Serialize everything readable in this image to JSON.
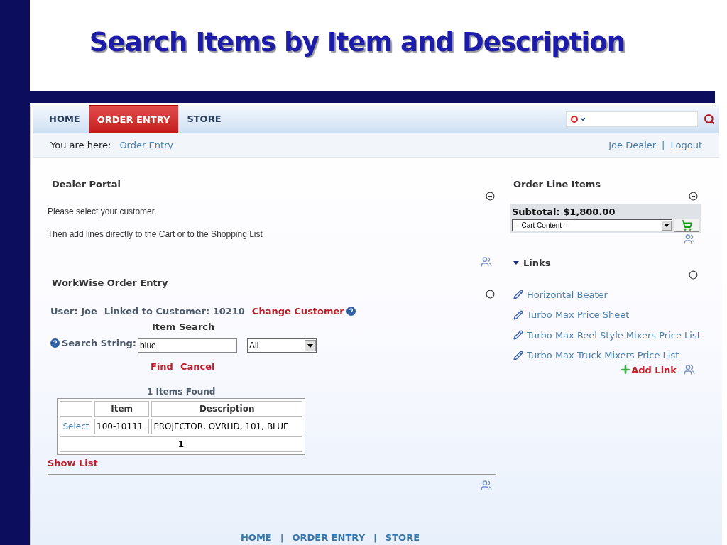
{
  "slide": {
    "title": "Search Items by Item and Description"
  },
  "nav": {
    "tabs": [
      {
        "label": "HOME",
        "selected": false
      },
      {
        "label": "ORDER ENTRY",
        "selected": true
      },
      {
        "label": "STORE",
        "selected": false
      }
    ]
  },
  "breadcrumb": {
    "label": "You are here:",
    "current": "Order Entry"
  },
  "user_links": {
    "items": [
      "Joe Dealer",
      "Logout"
    ],
    "separator": "|"
  },
  "dealer_portal": {
    "title": "Dealer Portal",
    "lines": [
      "Please select your customer,",
      "Then add lines directly to the Cart or to the Shopping List"
    ]
  },
  "order_entry": {
    "title": "WorkWise Order Entry",
    "user": "User: Joe",
    "customer": "Linked to Customer: 10210",
    "change_customer": "Change Customer",
    "search_title": "Item Search",
    "search_label": "Search String:",
    "search_value": "blue",
    "scope": "All",
    "find": "Find",
    "cancel": "Cancel",
    "results_count": "1 Items Found",
    "table": {
      "columns": [
        "Item",
        "Description"
      ],
      "rows": [
        {
          "action": "Select",
          "item": "100-10111",
          "description": "PROJECTOR, OVRHD, 101, BLUE"
        }
      ],
      "pager": "1"
    },
    "show_list": "Show List"
  },
  "order_line_items": {
    "title": "Order Line Items",
    "subtotal": "Subtotal: $1,800.00",
    "cart_select": "-- Cart Content --"
  },
  "links": {
    "title": "Links",
    "expanded": true,
    "items": [
      "Horizontal Beater",
      "Turbo Max Price Sheet",
      "Turbo Max Reel Style Mixers Price List",
      "Turbo Max Truck Mixers Price List"
    ],
    "add_link": "Add Link"
  },
  "footer": {
    "links": [
      "HOME",
      "ORDER ENTRY",
      "STORE"
    ],
    "separator": "|"
  }
}
